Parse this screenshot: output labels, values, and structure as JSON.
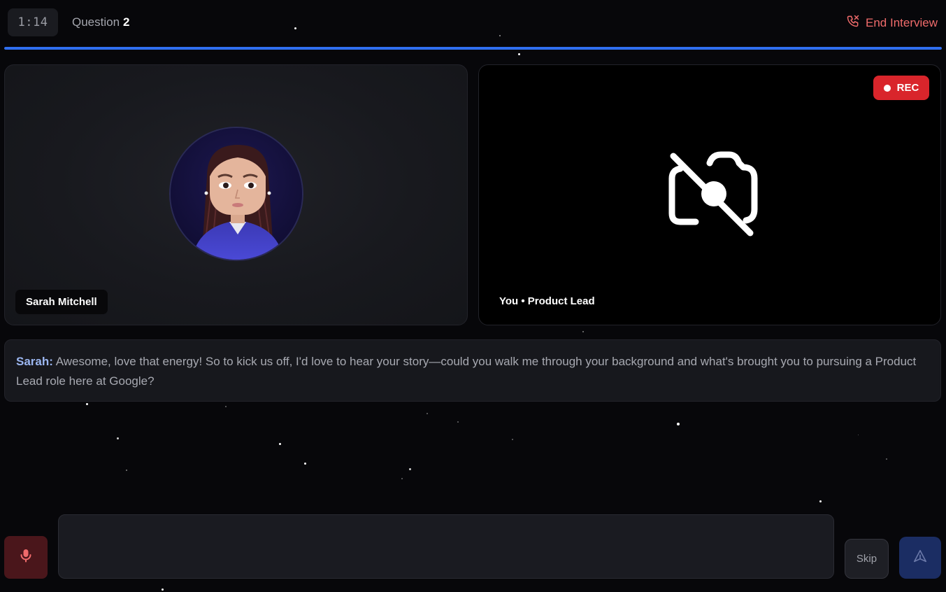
{
  "header": {
    "timer": "1:14",
    "question_label": "Question",
    "question_number": "2",
    "end_label": "End Interview",
    "progress_fraction": 1.0
  },
  "interviewer": {
    "name": "Sarah Mitchell"
  },
  "candidate": {
    "label": "You • Product Lead",
    "rec_label": "REC",
    "camera_state": "camera-off-icon"
  },
  "transcript": {
    "speaker": "Sarah:",
    "text": "Awesome, love that energy! So to kick us off, I'd love to hear your story—could you walk me through your background and what's brought you to pursuing a Product Lead role here at Google?"
  },
  "controls": {
    "mic_icon": "microphone-icon",
    "answer_value": "",
    "answer_placeholder": "",
    "skip_label": "Skip",
    "send_icon": "send-icon"
  },
  "colors": {
    "accent": "#2f6ff0",
    "danger": "#f06b6b",
    "rec": "#d9252b",
    "speaker": "#9bb6f0"
  }
}
